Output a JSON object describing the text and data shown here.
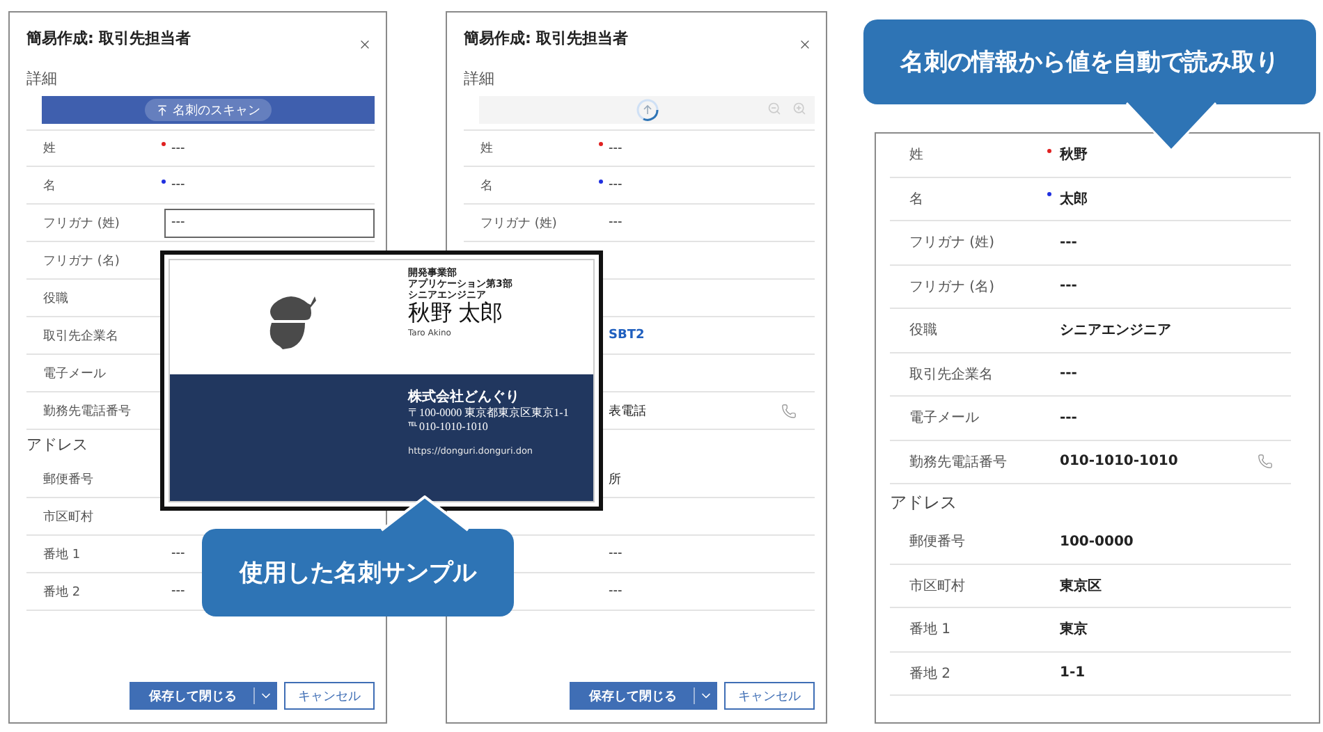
{
  "panels": [
    {
      "title": "簡易作成: 取引先担当者",
      "section": "詳細",
      "scan": {
        "kind": "button",
        "label": "名刺のスキャン"
      },
      "rows": [
        {
          "kind": "field",
          "label": "姓",
          "color": "#e02020",
          "value": "---"
        },
        {
          "kind": "field",
          "label": "名",
          "color": "#2030e0",
          "value": "---"
        },
        {
          "kind": "input",
          "label": "フリガナ (姓)",
          "value": "---"
        },
        {
          "kind": "field",
          "label": "フリガナ (名)"
        },
        {
          "kind": "field",
          "label": "役職"
        },
        {
          "kind": "field",
          "label": "取引先企業名"
        },
        {
          "kind": "field",
          "label": "電子メール"
        },
        {
          "kind": "field",
          "label": "勤務先電話番号"
        },
        {
          "kind": "heading",
          "label": "アドレス"
        },
        {
          "kind": "field",
          "label": "郵便番号"
        },
        {
          "kind": "field",
          "label": "市区町村"
        },
        {
          "kind": "field",
          "label": "番地 1",
          "value": "---"
        },
        {
          "kind": "field",
          "label": "番地 2",
          "value": "---"
        }
      ],
      "buttons": {
        "primary": "保存して閉じる",
        "secondary": "キャンセル"
      }
    },
    {
      "title": "簡易作成: 取引先担当者",
      "section": "詳細",
      "scan": {
        "kind": "loading"
      },
      "rows": [
        {
          "kind": "field",
          "label": "姓",
          "color": "#e02020",
          "value": "---"
        },
        {
          "kind": "field",
          "label": "名",
          "color": "#2030e0",
          "value": "---"
        },
        {
          "kind": "field",
          "label": "フリガナ (姓)",
          "value": "---"
        },
        {
          "kind": "field"
        },
        {
          "kind": "field"
        },
        {
          "kind": "field",
          "value": "SBT2",
          "link": true
        },
        {
          "kind": "field"
        },
        {
          "kind": "field",
          "value": "表電話",
          "phone": true
        },
        {
          "kind": "heading"
        },
        {
          "kind": "field",
          "value": "所"
        },
        {
          "kind": "field"
        },
        {
          "kind": "field",
          "value": "---"
        },
        {
          "kind": "field",
          "value": "---"
        }
      ],
      "buttons": {
        "primary": "保存して閉じる",
        "secondary": "キャンセル"
      }
    }
  ],
  "result_panel": {
    "rows": [
      {
        "kind": "field",
        "label": "姓",
        "color": "#e02020",
        "value": "秋野"
      },
      {
        "kind": "field",
        "label": "名",
        "color": "#2030e0",
        "value": "太郎"
      },
      {
        "kind": "field",
        "label": "フリガナ (姓)",
        "value": "---"
      },
      {
        "kind": "field",
        "label": "フリガナ (名)",
        "value": "---"
      },
      {
        "kind": "field",
        "label": "役職",
        "value": "シニアエンジニア"
      },
      {
        "kind": "field",
        "label": "取引先企業名",
        "value": "---"
      },
      {
        "kind": "field",
        "label": "電子メール",
        "value": "---"
      },
      {
        "kind": "field",
        "label": "勤務先電話番号",
        "value": "010-1010-1010",
        "phone": true
      },
      {
        "kind": "heading",
        "label": "アドレス"
      },
      {
        "kind": "field",
        "label": "郵便番号",
        "value": "100-0000"
      },
      {
        "kind": "field",
        "label": "市区町村",
        "value": "東京区"
      },
      {
        "kind": "field",
        "label": "番地 1",
        "value": "東京"
      },
      {
        "kind": "field",
        "label": "番地 2",
        "value": "1-1"
      }
    ]
  },
  "business_card": {
    "department": "開発事業部",
    "division": "アプリケーション第3部",
    "position": "シニアエンジニア",
    "name": "秋野 太郎",
    "romaji": "Taro Akino",
    "company": "株式会社どんぐり",
    "address": "〒100-0000 東京都東京区東京1-1",
    "tel": "℡ 010-1010-1010",
    "url": "https://donguri.donguri.don"
  },
  "callouts": [
    {
      "text": "名刺の情報から値を自動で読み取り"
    },
    {
      "text": "使用した名刺サンプル"
    }
  ]
}
